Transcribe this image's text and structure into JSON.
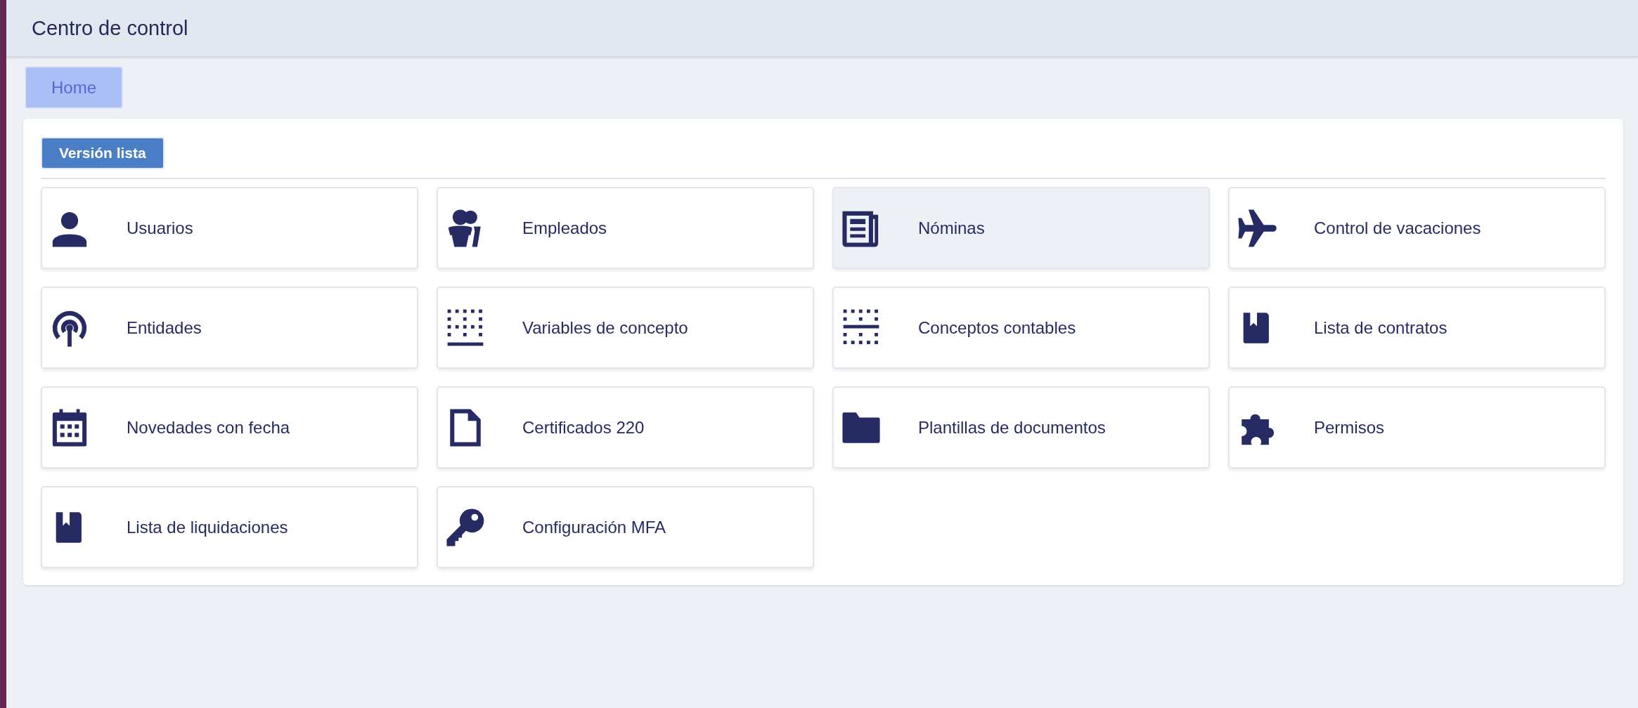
{
  "header": {
    "title": "Centro de control"
  },
  "breadcrumb": [
    {
      "label": "Home",
      "selected": true
    }
  ],
  "panel": {
    "list_button": "Versión lista",
    "items": [
      {
        "label": "Usuarios",
        "highlighted": false
      },
      {
        "label": "Empleados",
        "highlighted": false
      },
      {
        "label": "Nóminas",
        "highlighted": true
      },
      {
        "label": "Control de vacaciones",
        "highlighted": false
      },
      {
        "label": "Entidades",
        "highlighted": false
      },
      {
        "label": "Variables de concepto",
        "highlighted": false
      },
      {
        "label": "Conceptos contables",
        "highlighted": false
      },
      {
        "label": "Lista de contratos",
        "highlighted": false
      },
      {
        "label": "Novedades con fecha",
        "highlighted": false
      },
      {
        "label": "Certificados 220",
        "highlighted": false
      },
      {
        "label": "Plantillas de documentos",
        "highlighted": false
      },
      {
        "label": "Permisos",
        "highlighted": false
      },
      {
        "label": "Lista de liquidaciones",
        "highlighted": false
      },
      {
        "label": "Configuración MFA",
        "highlighted": false
      }
    ]
  }
}
